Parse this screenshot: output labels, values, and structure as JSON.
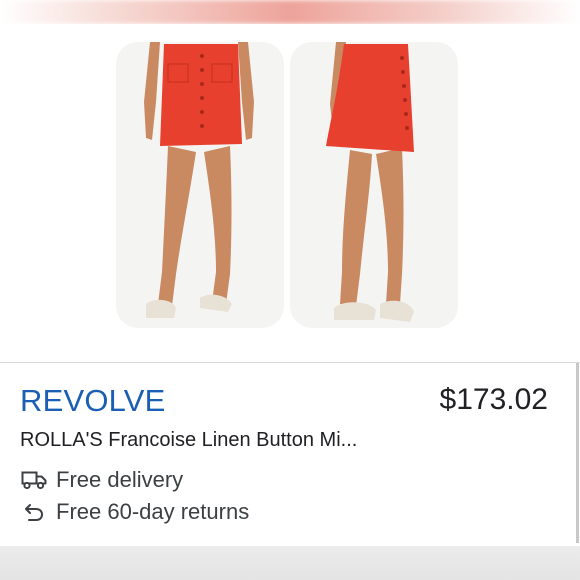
{
  "listing": {
    "store_name": "REVOLVE",
    "price": "$173.02",
    "product_title": "ROLLA'S Francoise Linen Button Mi...",
    "features": [
      {
        "icon": "delivery-truck-icon",
        "label": "Free delivery"
      },
      {
        "icon": "return-arrow-icon",
        "label": "Free 60-day returns"
      }
    ]
  },
  "colors": {
    "store_link": "#1a5fb4",
    "skirt": "#e8402f",
    "text": "#202124"
  }
}
